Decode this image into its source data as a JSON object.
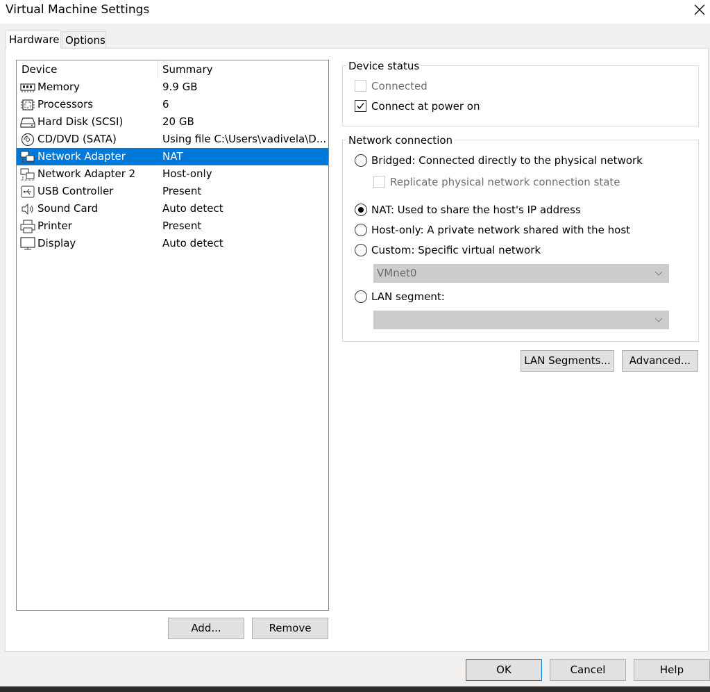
{
  "window": {
    "title": "Virtual Machine Settings"
  },
  "tabs": [
    {
      "label": "Hardware",
      "active": true
    },
    {
      "label": "Options",
      "active": false
    }
  ],
  "device_list": {
    "headers": {
      "device": "Device",
      "summary": "Summary"
    },
    "rows": [
      {
        "name": "Memory",
        "summary": "9.9 GB",
        "icon": "memory-icon"
      },
      {
        "name": "Processors",
        "summary": "6",
        "icon": "processor-icon"
      },
      {
        "name": "Hard Disk (SCSI)",
        "summary": "20 GB",
        "icon": "hard-disk-icon"
      },
      {
        "name": "CD/DVD (SATA)",
        "summary": "Using file C:\\Users\\vadivela\\D...",
        "icon": "cd-dvd-icon"
      },
      {
        "name": "Network Adapter",
        "summary": "NAT",
        "icon": "network-adapter-icon",
        "selected": true
      },
      {
        "name": "Network Adapter 2",
        "summary": "Host-only",
        "icon": "network-adapter-icon"
      },
      {
        "name": "USB Controller",
        "summary": "Present",
        "icon": "usb-icon"
      },
      {
        "name": "Sound Card",
        "summary": "Auto detect",
        "icon": "speaker-icon"
      },
      {
        "name": "Printer",
        "summary": "Present",
        "icon": "printer-icon"
      },
      {
        "name": "Display",
        "summary": "Auto detect",
        "icon": "monitor-icon"
      }
    ]
  },
  "list_buttons": {
    "add": "Add...",
    "remove": "Remove"
  },
  "device_status": {
    "legend": "Device status",
    "connected": {
      "label": "Connected",
      "checked": false,
      "enabled": false
    },
    "connect_at_power_on": {
      "label": "Connect at power on",
      "checked": true,
      "enabled": true
    }
  },
  "network_connection": {
    "legend": "Network connection",
    "bridged": {
      "label": "Bridged: Connected directly to the physical network",
      "selected": false
    },
    "replicate": {
      "label": "Replicate physical network connection state",
      "checked": false,
      "enabled": false
    },
    "nat": {
      "label": "NAT: Used to share the host's IP address",
      "selected": true
    },
    "host_only": {
      "label": "Host-only: A private network shared with the host",
      "selected": false
    },
    "custom": {
      "label": "Custom: Specific virtual network",
      "selected": false
    },
    "custom_network_value": "VMnet0",
    "lan_segment": {
      "label": "LAN segment:",
      "selected": false
    },
    "lan_segment_value": ""
  },
  "network_buttons": {
    "lan_segments": "LAN Segments...",
    "advanced": "Advanced..."
  },
  "dialog_buttons": {
    "ok": "OK",
    "cancel": "Cancel",
    "help": "Help"
  },
  "colors": {
    "selection": "#0078d7",
    "panel": "#ffffff",
    "background": "#f0f0f0"
  }
}
